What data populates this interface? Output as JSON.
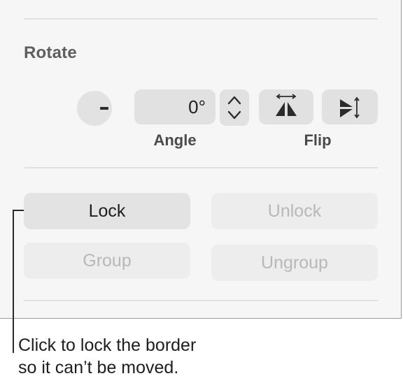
{
  "rotate": {
    "title": "Rotate",
    "angle_value": "0°",
    "angle_label": "Angle",
    "flip_label": "Flip"
  },
  "arrange": {
    "lock_label": "Lock",
    "unlock_label": "Unlock",
    "group_label": "Group",
    "ungroup_label": "Ungroup"
  },
  "callout": {
    "line1": "Click to lock the border",
    "line2": "so it can’t be moved."
  },
  "icons": {
    "stepper": "chevron-up-down-icon",
    "flip_horizontal": "flip-horizontal-icon",
    "flip_vertical": "flip-vertical-icon",
    "rotate_knob": "rotation-knob"
  },
  "colors": {
    "panel_background": "#f6f6f6",
    "control_background": "#e1e1e1",
    "disabled_text": "#b8b8b8",
    "title_text": "#5f5f5f"
  }
}
